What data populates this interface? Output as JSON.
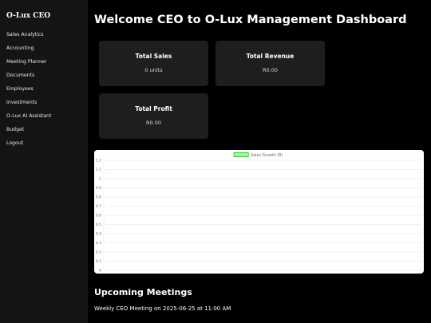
{
  "sidebar": {
    "brand": "O-Lux CEO",
    "items": [
      {
        "label": "Sales Analytics"
      },
      {
        "label": "Accounting"
      },
      {
        "label": "Meeting Planner"
      },
      {
        "label": "Documents"
      },
      {
        "label": "Employees"
      },
      {
        "label": "Investments"
      },
      {
        "label": "O-Lux AI Assistant"
      },
      {
        "label": "Budget"
      },
      {
        "label": "Logout"
      }
    ]
  },
  "header": {
    "title": "Welcome CEO to O-Lux Management Dashboard"
  },
  "cards": {
    "sales": {
      "title": "Total Sales",
      "value": "0 units"
    },
    "revenue": {
      "title": "Total Revenue",
      "value": "R0.00"
    },
    "profit": {
      "title": "Total Profit",
      "value": "R0.00"
    }
  },
  "chart_data": {
    "type": "line",
    "series": [
      {
        "name": "Sales Growth (R)",
        "values": []
      }
    ],
    "categories": [],
    "yticks": [
      "1.2",
      "1.1",
      "1",
      "0.9",
      "0.8",
      "0.7",
      "0.6",
      "0.5",
      "0.4",
      "0.3",
      "0.2",
      "0.1",
      "0"
    ],
    "ylim": [
      0,
      1.2
    ],
    "grid": true,
    "legend": "top-center",
    "colors": {
      "series": "#33cc33",
      "series_fill": "#b3f0b3",
      "grid": "#e6e6e6",
      "tick": "#666666"
    }
  },
  "meetings": {
    "title": "Upcoming Meetings",
    "items": [
      {
        "text": "Weekly CEO Meeting on 2025-06-25 at 11:00 AM"
      }
    ]
  }
}
